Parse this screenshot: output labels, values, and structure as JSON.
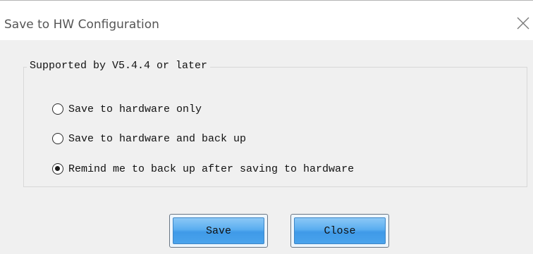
{
  "dialog": {
    "title": "Save to HW Configuration",
    "close_icon": "close-icon"
  },
  "group": {
    "legend": "Supported by V5.4.4 or later",
    "options": [
      {
        "label": "Save to hardware only",
        "checked": false
      },
      {
        "label": "Save to hardware and back up",
        "checked": false
      },
      {
        "label": "Remind me to back up after saving to hardware",
        "checked": true
      }
    ]
  },
  "buttons": {
    "save_label": "Save",
    "close_label": "Close"
  },
  "colors": {
    "button_accent": "#4aa3ec",
    "dialog_background": "#f0f0f0"
  }
}
